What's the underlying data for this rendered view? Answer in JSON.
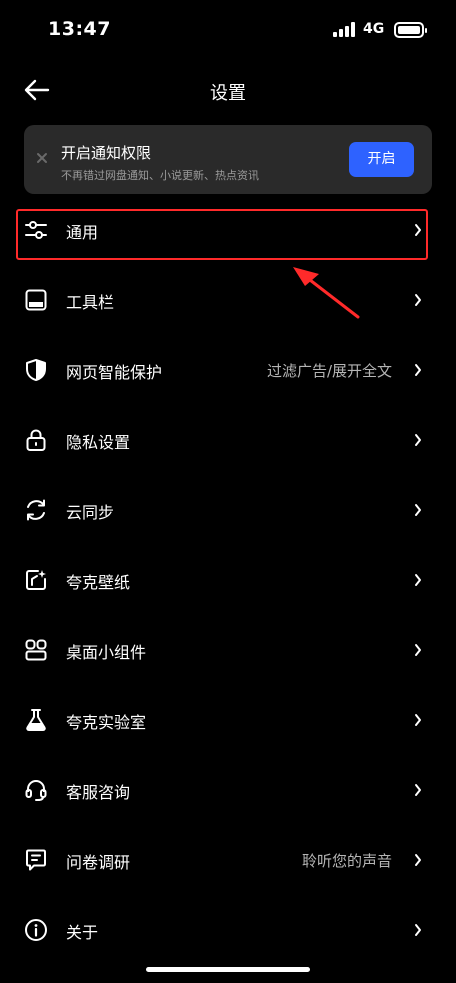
{
  "status_bar": {
    "time": "13:47",
    "network": "4G"
  },
  "nav": {
    "back_icon": "arrow-left-icon",
    "title": "设置"
  },
  "notify_banner": {
    "close_icon": "close-icon",
    "title": "开启通知权限",
    "subtitle": "不再错过网盘通知、小说更新、热点资讯",
    "button_label": "开启",
    "button_color": "#2e62ff"
  },
  "settings": {
    "items": [
      {
        "icon": "sliders-icon",
        "label": "通用",
        "value": ""
      },
      {
        "icon": "toolbar-icon",
        "label": "工具栏",
        "value": ""
      },
      {
        "icon": "shield-icon",
        "label": "网页智能保护",
        "value": "过滤广告/展开全文"
      },
      {
        "icon": "lock-icon",
        "label": "隐私设置",
        "value": ""
      },
      {
        "icon": "sync-icon",
        "label": "云同步",
        "value": ""
      },
      {
        "icon": "wallpaper-icon",
        "label": "夸克壁纸",
        "value": ""
      },
      {
        "icon": "widgets-icon",
        "label": "桌面小组件",
        "value": ""
      },
      {
        "icon": "flask-icon",
        "label": "夸克实验室",
        "value": ""
      },
      {
        "icon": "headset-icon",
        "label": "客服咨询",
        "value": ""
      },
      {
        "icon": "survey-icon",
        "label": "问卷调研",
        "value": "聆听您的声音"
      },
      {
        "icon": "info-icon",
        "label": "关于",
        "value": ""
      }
    ]
  },
  "annotation": {
    "highlight_color": "#ff2a2a"
  }
}
